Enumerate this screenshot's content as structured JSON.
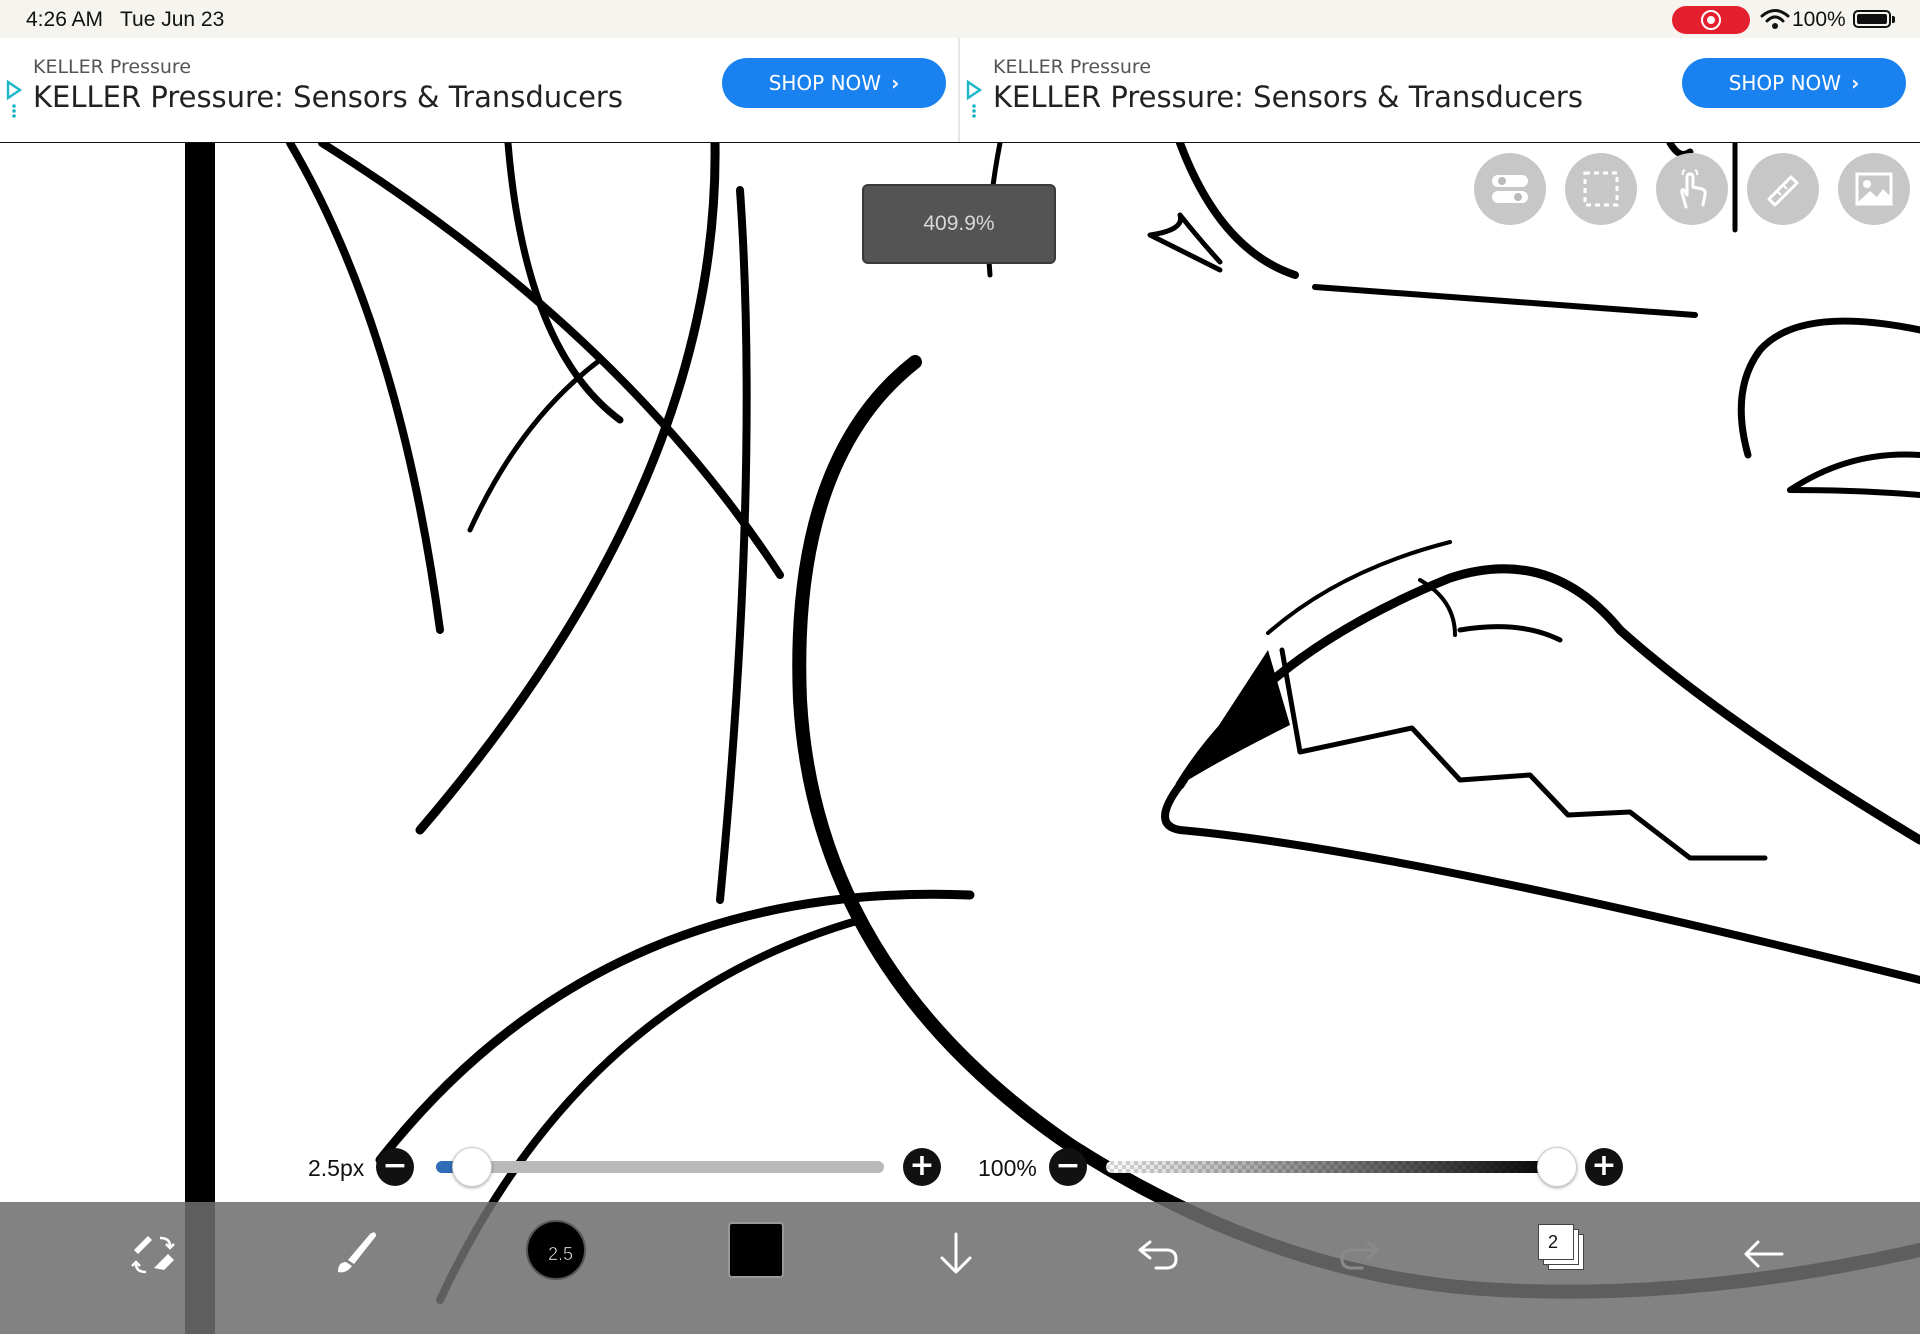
{
  "status_bar": {
    "time": "4:26 AM",
    "date": "Tue Jun 23",
    "battery": "100%"
  },
  "ads": [
    {
      "source": "KELLER Pressure",
      "title": "KELLER Pressure: Sensors & Transducers",
      "cta": "SHOP NOW"
    },
    {
      "source": "KELLER Pressure",
      "title": "KELLER Pressure: Sensors & Transducers",
      "cta": "SHOP NOW"
    }
  ],
  "canvas": {
    "zoom": "409.9%"
  },
  "top_tools": [
    "toggle-icon",
    "selection-icon",
    "hand-gesture-icon",
    "ruler-icon",
    "image-icon"
  ],
  "brush_size": {
    "label": "2.5px",
    "value": 2.5,
    "slider_fraction": 0.06
  },
  "opacity": {
    "label": "100%",
    "value": 100
  },
  "toolbar": {
    "brush_size_badge": "2.5",
    "color": "#000000",
    "layer_count": "2"
  },
  "colors": {
    "ad_button": "#1a82f0",
    "record": "#e5202e",
    "slider_fill": "#2f6db7"
  }
}
